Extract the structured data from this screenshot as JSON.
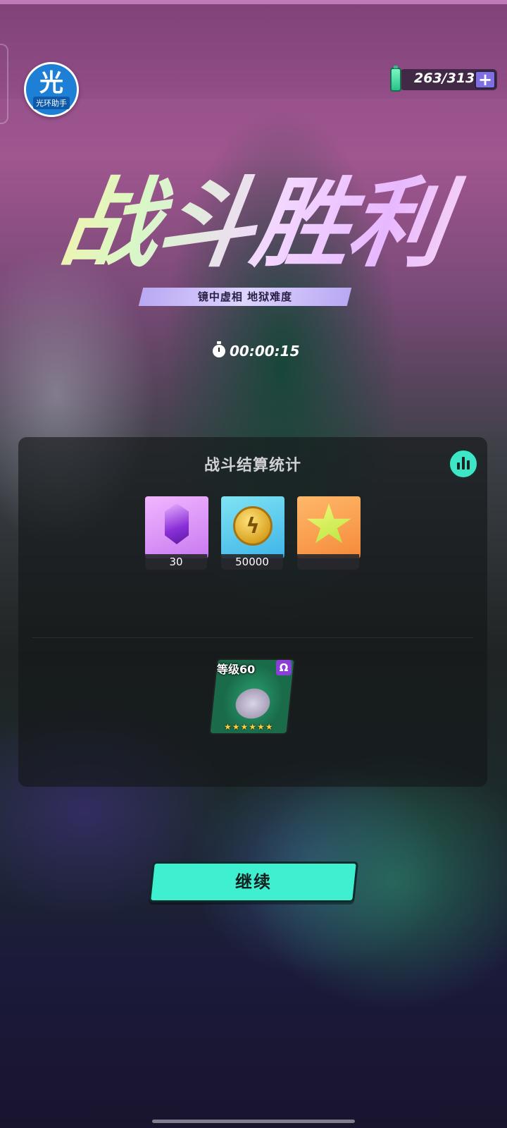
{
  "helper_badge": {
    "char": "光",
    "label": "光环助手"
  },
  "energy": {
    "value": "263/313",
    "add_label": "+"
  },
  "result": {
    "title": "战斗胜利",
    "subtitle": "镜中虚相  地狱难度",
    "time": "00:00:15"
  },
  "panel": {
    "title": "战斗结算统计",
    "rewards": [
      {
        "icon": "purple-gem-icon",
        "count": "30"
      },
      {
        "icon": "gold-coin-icon",
        "count": "50000"
      },
      {
        "icon": "star-emblem-icon",
        "count": ""
      }
    ],
    "hero": {
      "level": "等级60",
      "class_symbol": "Ω",
      "stars": "★★★★★★"
    }
  },
  "continue_label": "继续",
  "colors": {
    "accent": "#3ef0d0",
    "energy_plus": "#7f6fe0",
    "subtitle_bar": "#c9bcf8"
  }
}
